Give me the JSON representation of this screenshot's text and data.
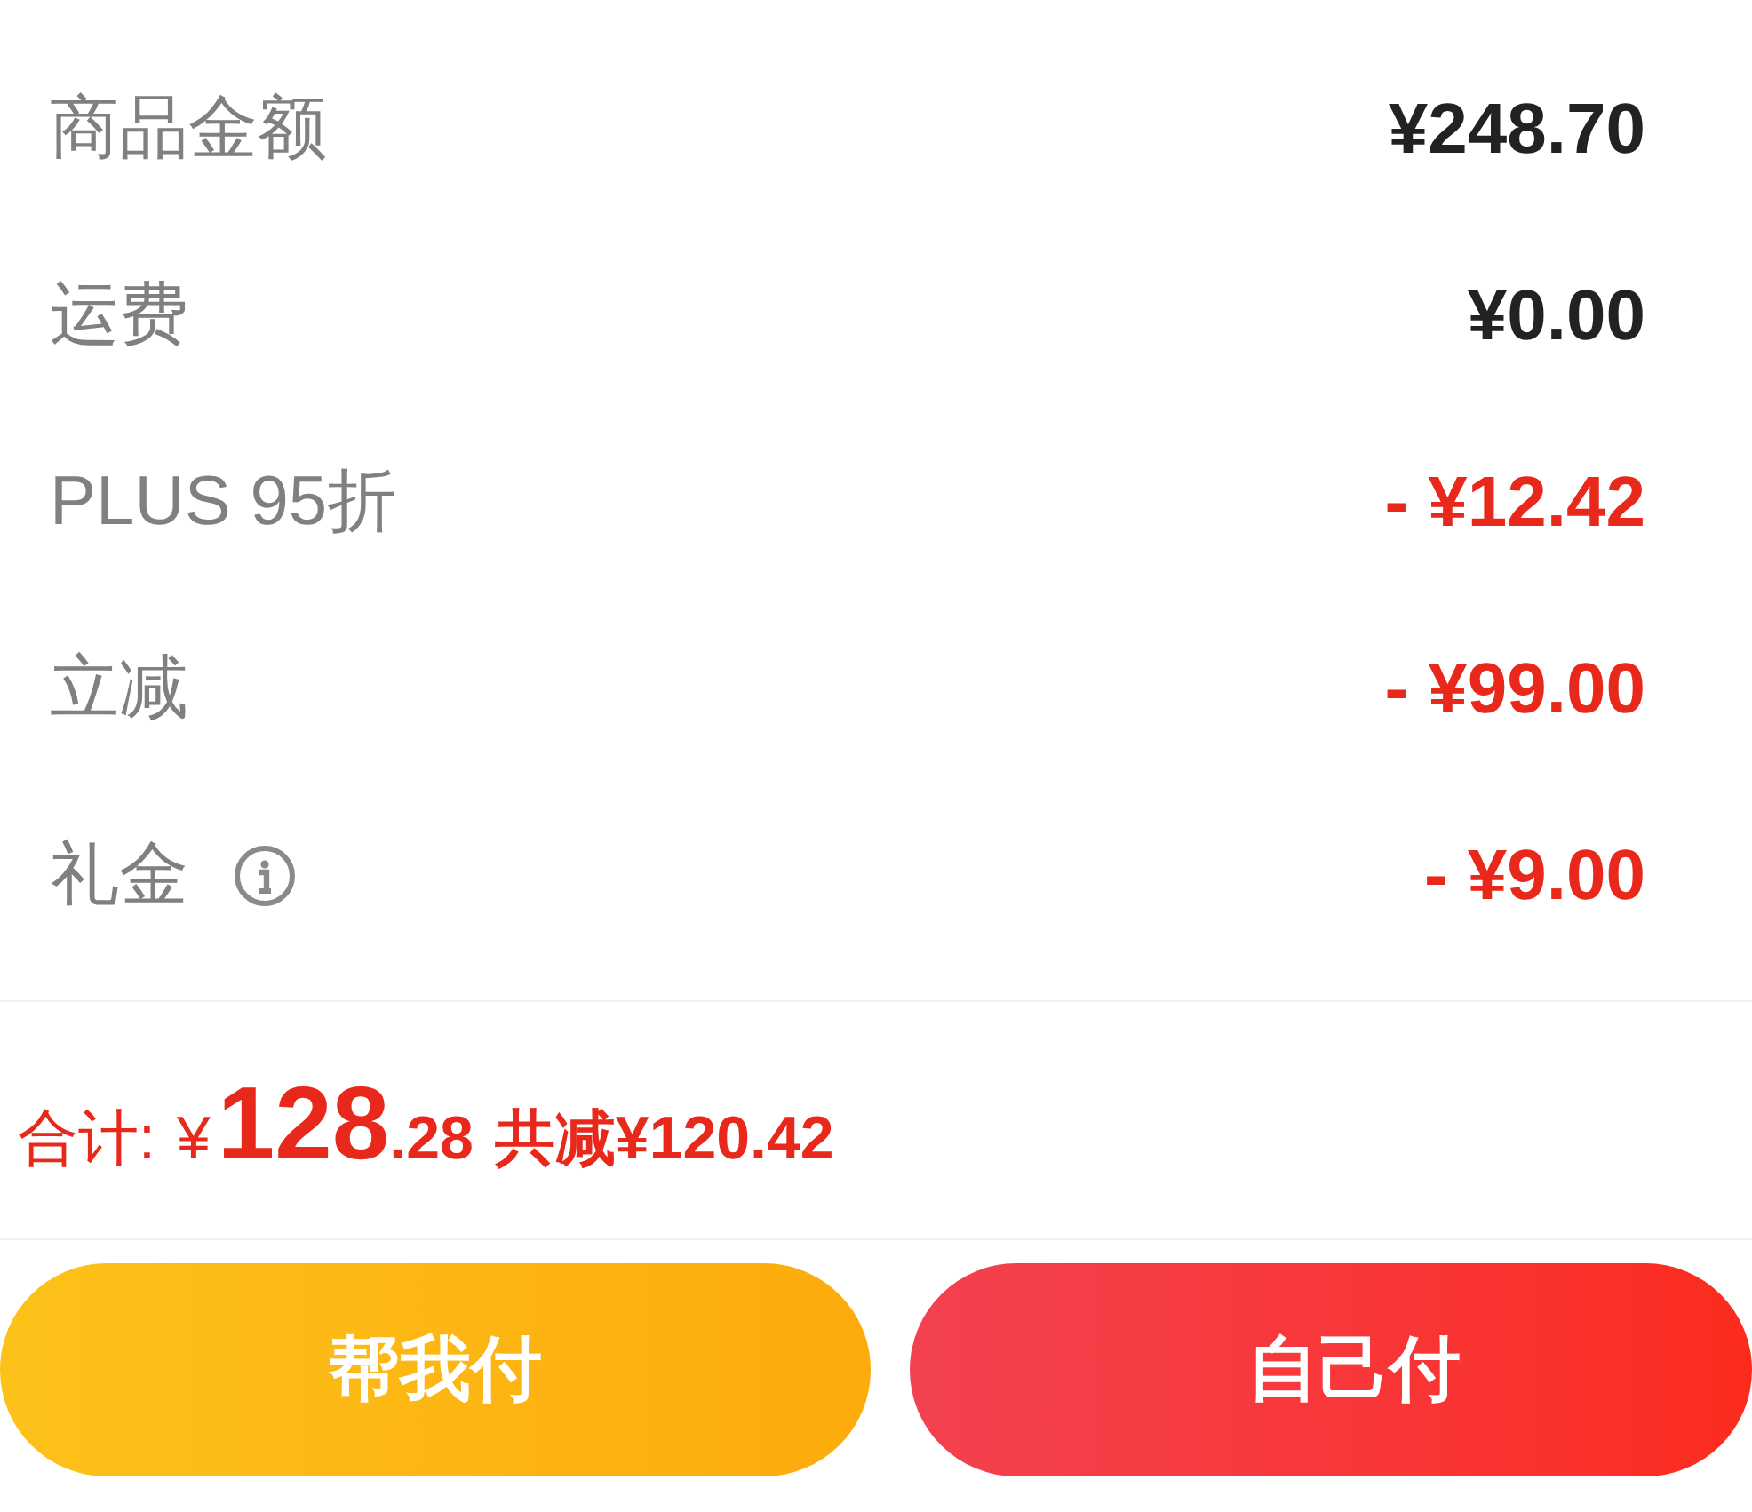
{
  "rows": [
    {
      "label": "商品金额",
      "value": "¥248.70",
      "kind": "amount",
      "info": false
    },
    {
      "label": "运费",
      "value": "¥0.00",
      "kind": "amount",
      "info": false
    },
    {
      "label": "PLUS 95折",
      "value": "- ¥12.42",
      "kind": "discount",
      "info": false
    },
    {
      "label": "立减",
      "value": "- ¥99.00",
      "kind": "discount",
      "info": false
    },
    {
      "label": "礼金",
      "value": "- ¥9.00",
      "kind": "discount",
      "info": true
    }
  ],
  "total": {
    "label": "合计:",
    "amount": {
      "currency": "¥",
      "integer": "128",
      "decimal": ".28"
    },
    "saving": "共减¥120.42"
  },
  "buttons": [
    {
      "label": "帮我付",
      "kind": "secondary"
    },
    {
      "label": "自己付",
      "kind": "primary"
    }
  ]
}
